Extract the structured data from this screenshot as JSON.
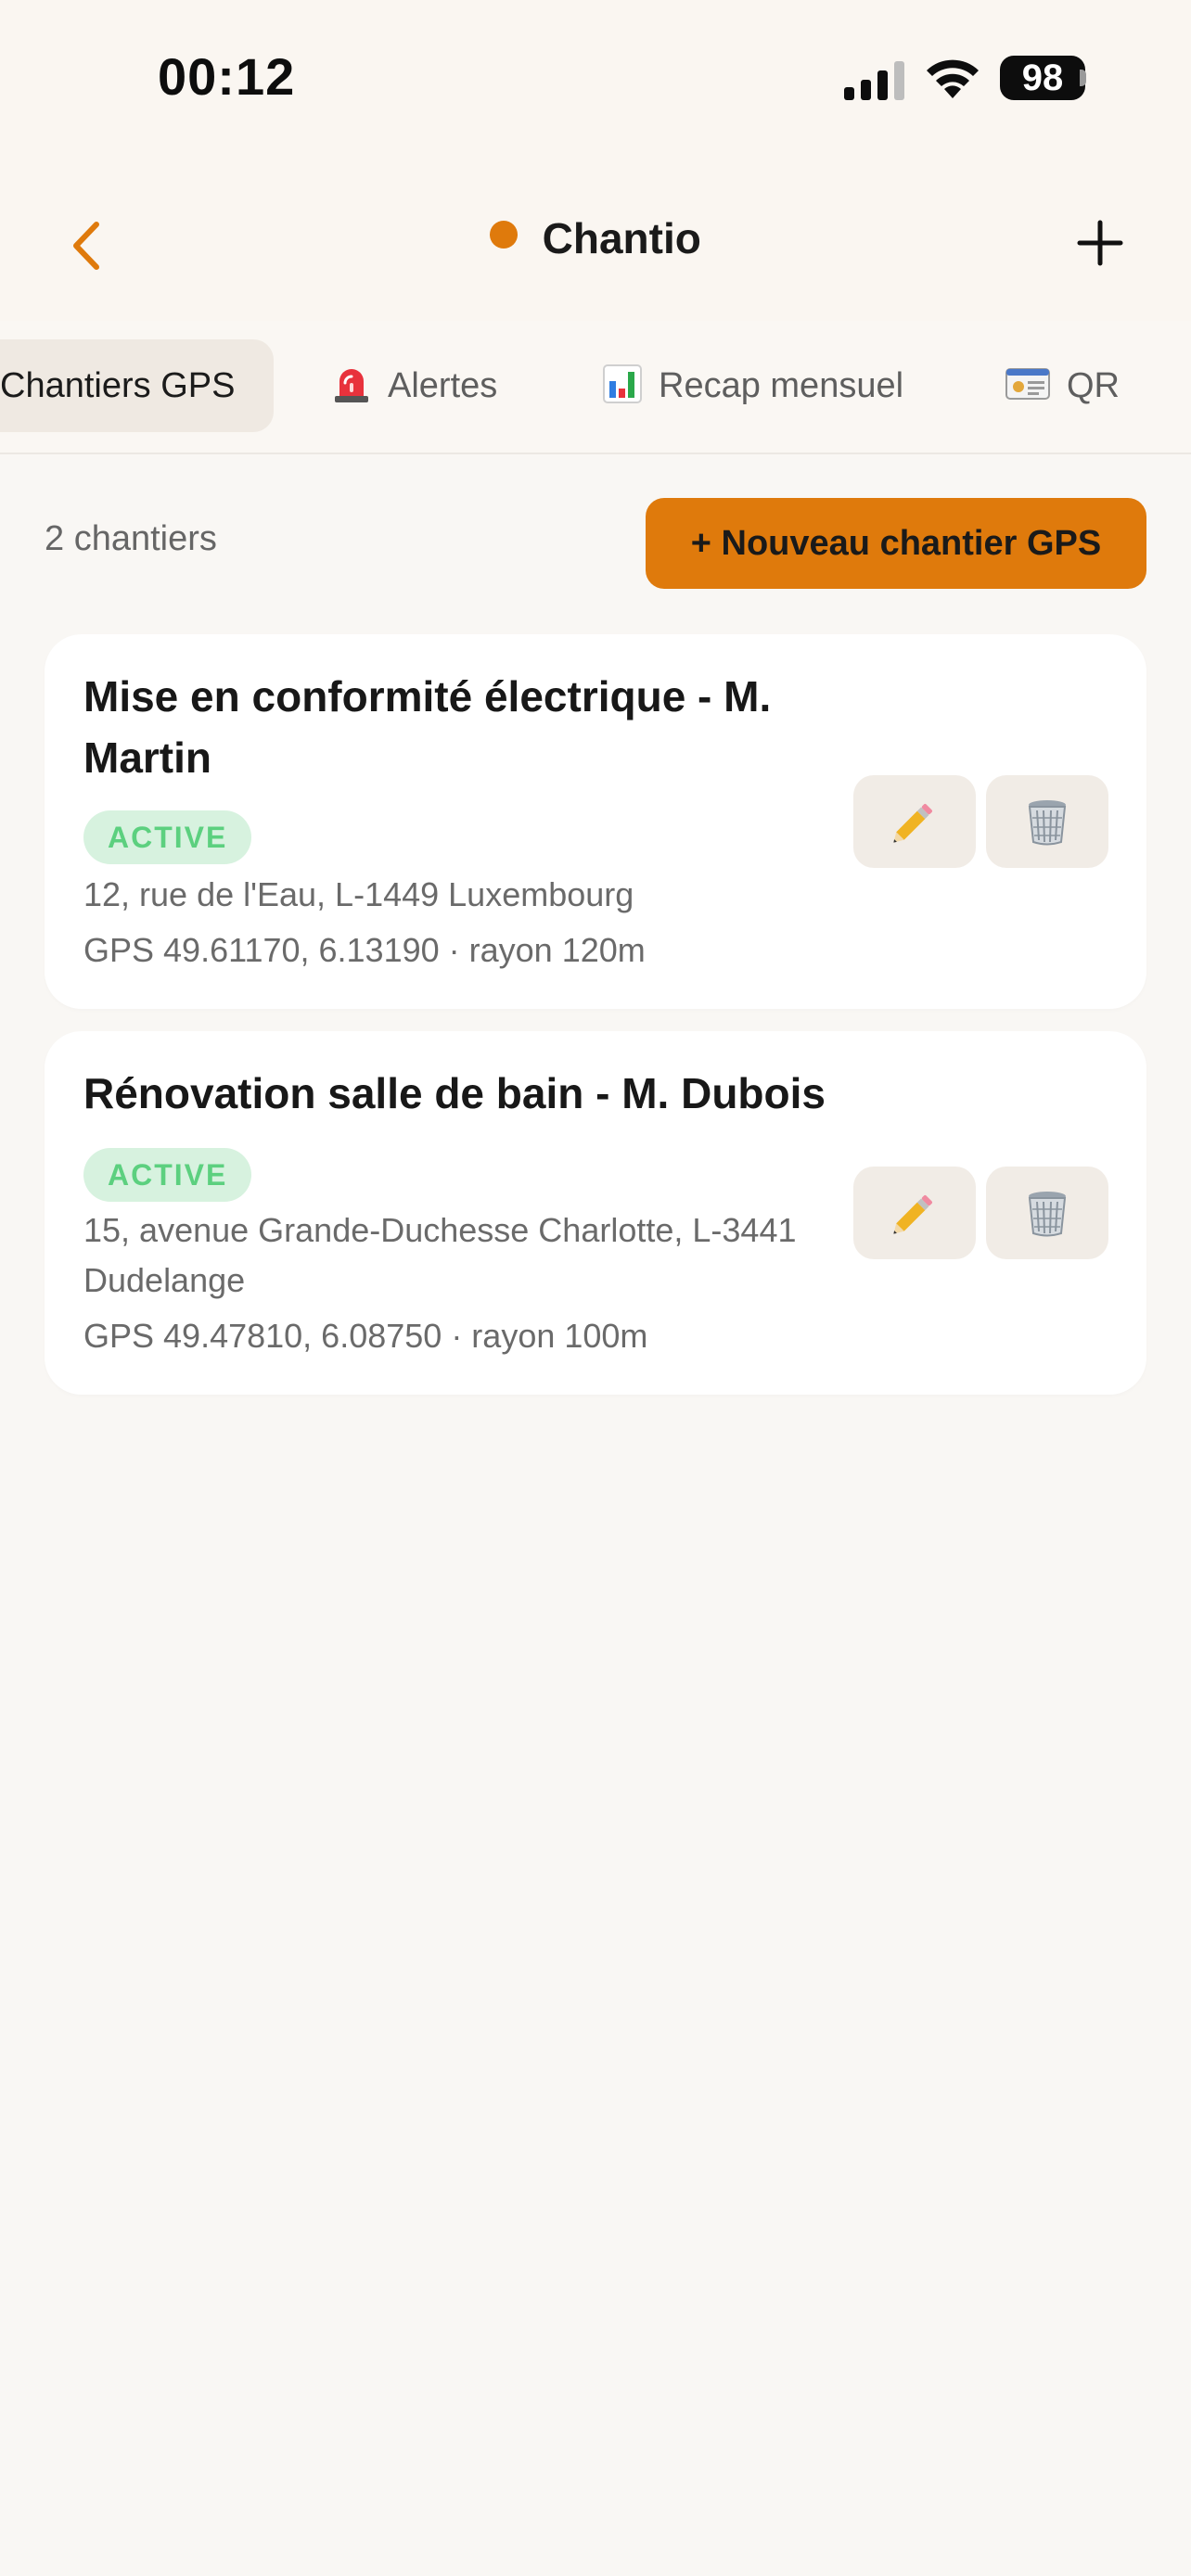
{
  "status_bar": {
    "time": "00:12",
    "battery": "98"
  },
  "nav": {
    "title": "Chantio",
    "accent_color": "#df7a0c"
  },
  "tabs": [
    {
      "label": "Chantiers GPS",
      "icon": "",
      "active": true
    },
    {
      "label": "Alertes",
      "icon": "siren-icon",
      "active": false
    },
    {
      "label": "Recap mensuel",
      "icon": "bar-chart-icon",
      "active": false
    },
    {
      "label": "QR",
      "icon": "id-card-icon",
      "active": false
    }
  ],
  "list": {
    "count_label": "2 chantiers",
    "new_button_label": "+ Nouveau chantier GPS"
  },
  "sites": [
    {
      "title": "Mise en conformité électrique - M. Martin",
      "status": "ACTIVE",
      "address": "12, rue de l'Eau, L-1449 Luxembourg",
      "gps": "GPS 49.61170, 6.13190 · rayon 120m"
    },
    {
      "title": "Rénovation salle de bain - M. Dubois",
      "status": "ACTIVE",
      "address": "15, avenue Grande-Duchesse Charlotte, L-3441 Dudelange",
      "gps": "GPS 49.47810, 6.08750 · rayon 100m"
    }
  ],
  "colors": {
    "accent": "#df7a0c",
    "badge_bg": "#d7f2df",
    "badge_text": "#5cd07f",
    "background": "#f9f7f4"
  }
}
